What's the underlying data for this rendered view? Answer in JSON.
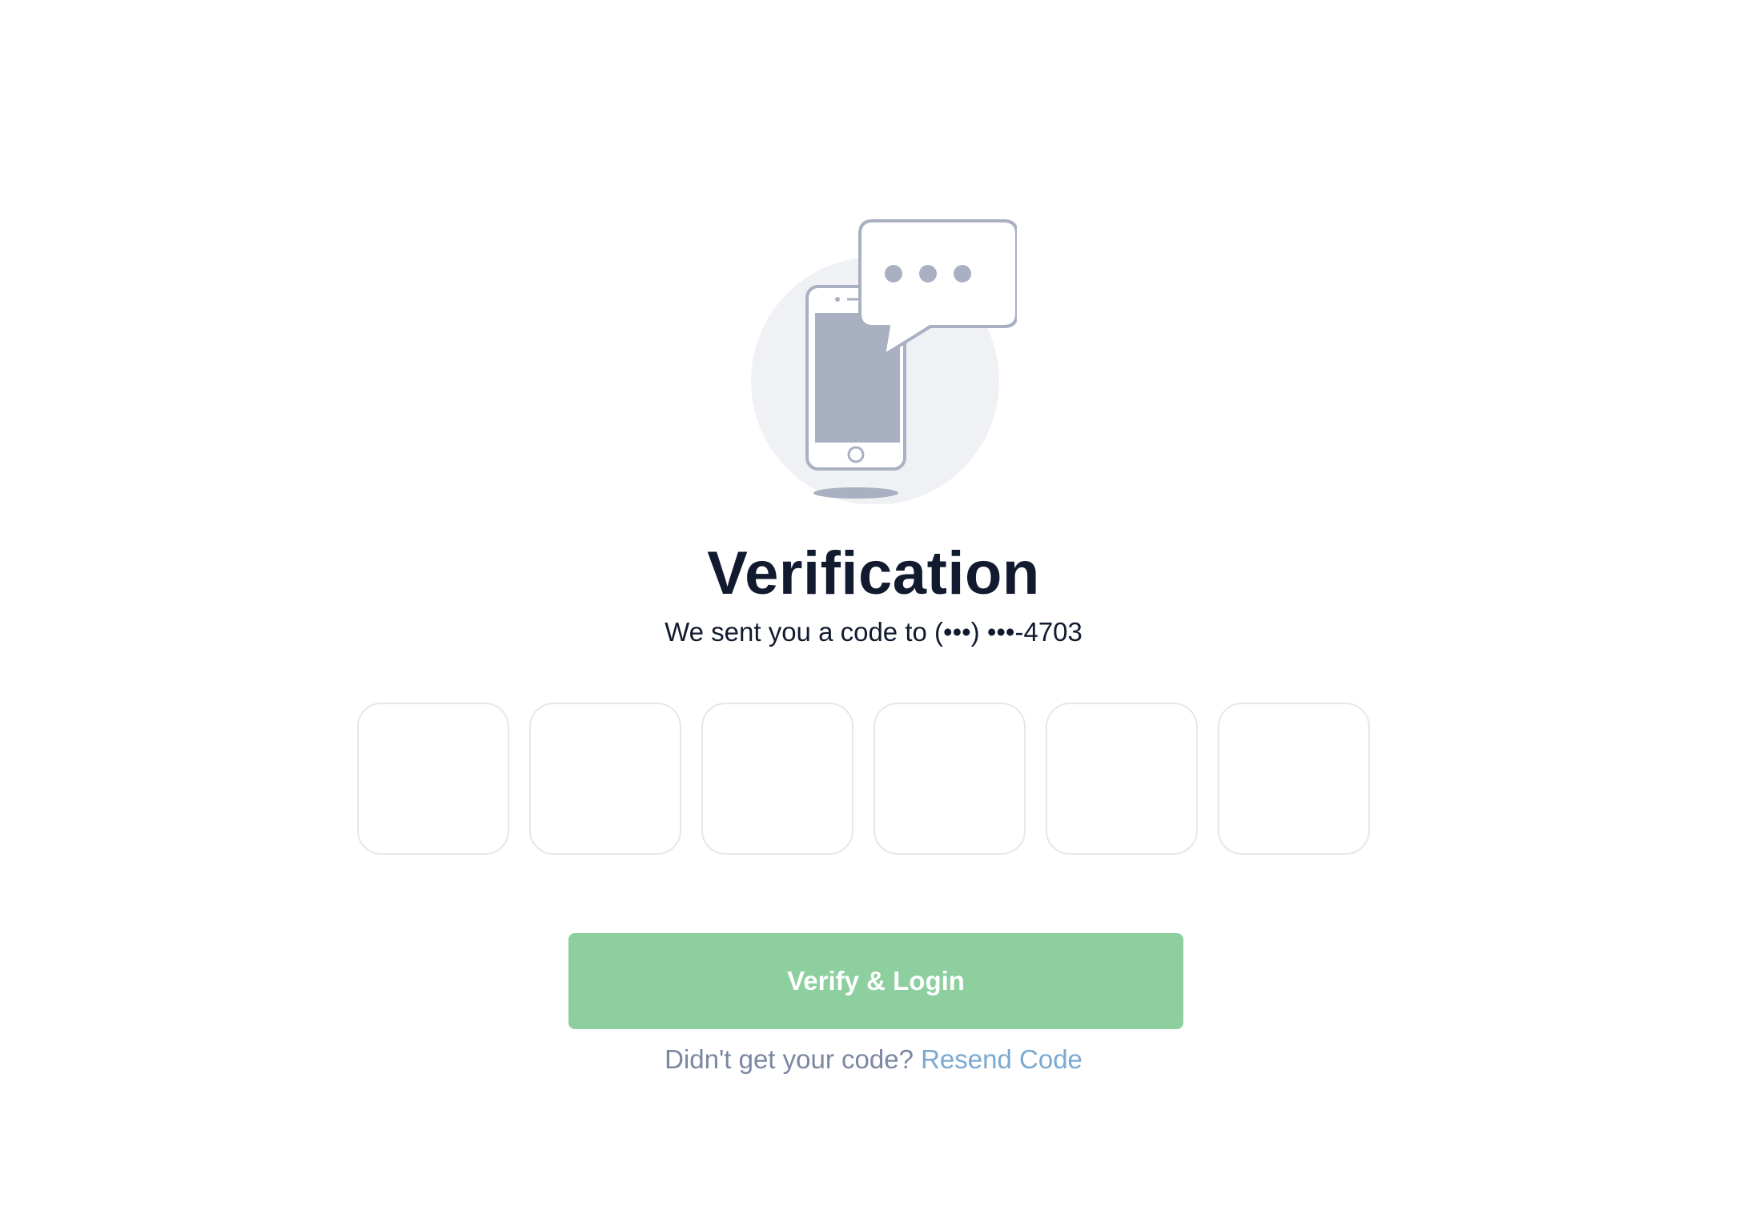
{
  "verification": {
    "title": "Verification",
    "subtitle": "We sent you a code to (•••) •••-4703",
    "code_digits": [
      "",
      "",
      "",
      "",
      "",
      ""
    ]
  },
  "actions": {
    "verify_label": "Verify & Login",
    "resend_prompt": "Didn't get your code?",
    "resend_link": "Resend Code"
  },
  "icons": {
    "illustration": "phone-message-icon"
  },
  "colors": {
    "title": "#111a2e",
    "button_bg": "#8dcf9f",
    "button_text": "#ffffff",
    "muted_text": "#7b87a1",
    "link": "#7ba9d1",
    "input_border": "#e6e7ea",
    "illustration_gray": "#a9b0c2",
    "illustration_circle": "#f0f1f5"
  }
}
